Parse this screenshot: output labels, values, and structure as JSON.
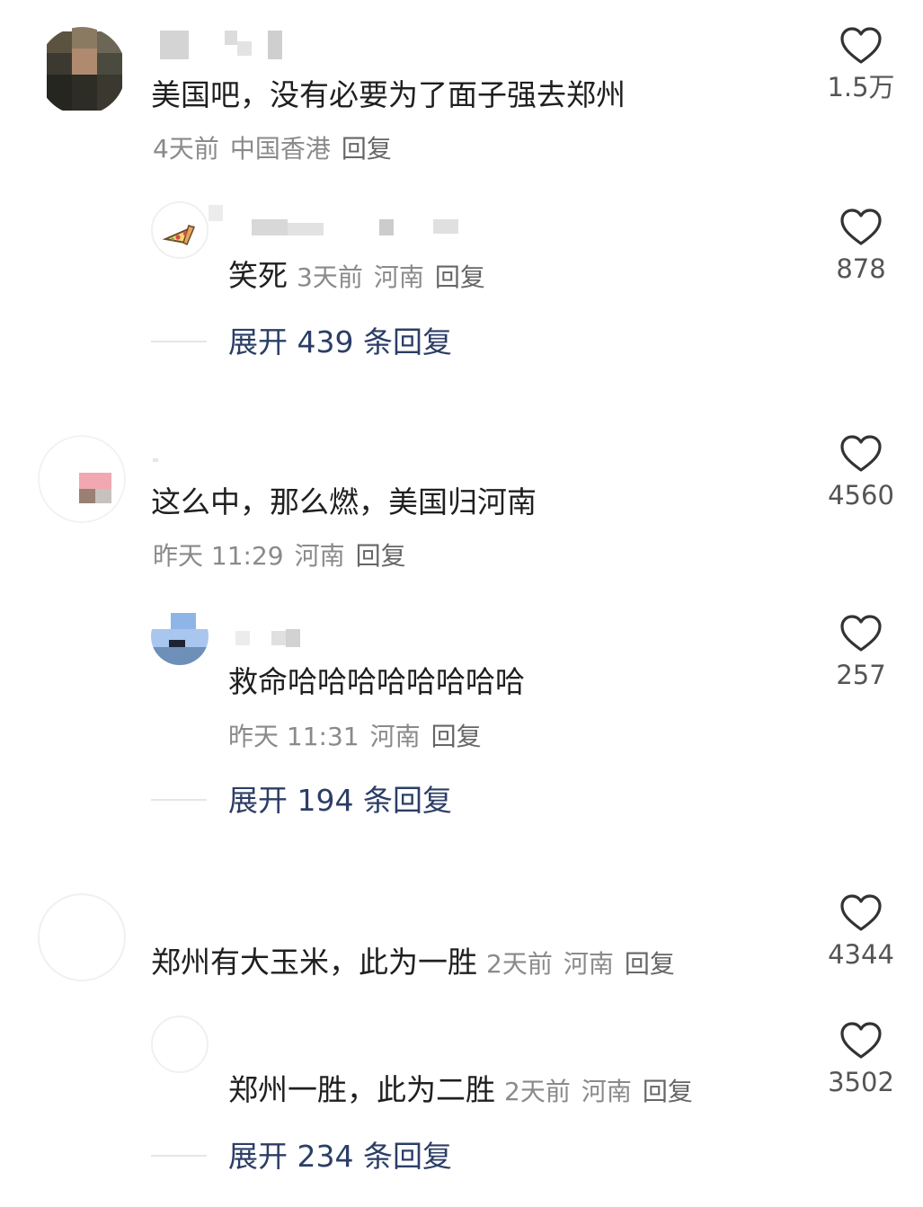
{
  "colors": {
    "text": "#1f1f1f",
    "meta": "#8a8a8a",
    "expand": "#2c3e66",
    "icon": "#333333"
  },
  "comments": [
    {
      "text": "美国吧，没有必要为了面子强去郑州",
      "time": "4天前",
      "location": "中国香港",
      "reply": "回复",
      "likes": "1.5万",
      "like_icon": "heart-outline-icon",
      "sub": {
        "text": "笑死",
        "time": "3天前",
        "location": "河南",
        "reply": "回复",
        "likes": "878",
        "avatar_icon": "pizza-icon"
      },
      "expand": "展开 439 条回复"
    },
    {
      "text": "这么中，那么燃，美国归河南",
      "time": "昨天 11:29",
      "location": "河南",
      "reply": "回复",
      "likes": "4560",
      "sub": {
        "text": "救命哈哈哈哈哈哈哈哈",
        "time": "昨天 11:31",
        "location": "河南",
        "reply": "回复",
        "likes": "257"
      },
      "expand": "展开 194 条回复"
    },
    {
      "text": "郑州有大玉米，此为一胜",
      "time": "2天前",
      "location": "河南",
      "reply": "回复",
      "likes": "4344",
      "sub": {
        "text": "郑州一胜，此为二胜",
        "time": "2天前",
        "location": "河南",
        "reply": "回复",
        "likes": "3502"
      },
      "expand": "展开 234 条回复"
    }
  ]
}
